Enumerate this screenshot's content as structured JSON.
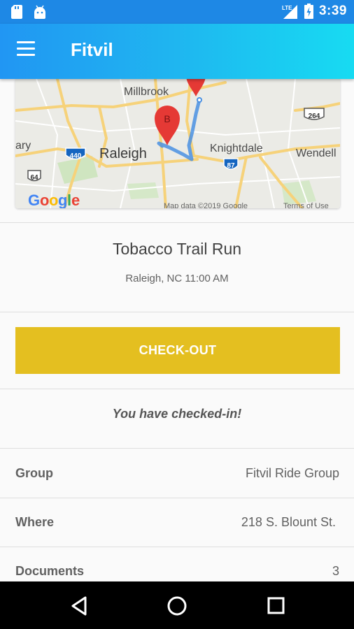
{
  "status_bar": {
    "time": "3:39",
    "network_label": "LTE",
    "icons": [
      "sd-card-icon",
      "android-icon",
      "signal-icon",
      "battery-charging-icon"
    ]
  },
  "app_bar": {
    "title": "Fitvil",
    "menu_icon": "hamburger-menu-icon"
  },
  "map": {
    "labels": {
      "millbrook": "Millbrook",
      "raleigh": "Raleigh",
      "knightdale": "Knightdale",
      "wendell": "Wendell",
      "cary": "ary"
    },
    "shields": {
      "i440": "440",
      "i87": "87",
      "us264": "264",
      "us64": "64"
    },
    "marker_b": "B",
    "attribution": "Map data ©2019 Google",
    "terms": "Terms of Use",
    "logo_text": "Google"
  },
  "event": {
    "title": "Tobacco Trail Run",
    "subtitle": "Raleigh, NC 11:00 AM"
  },
  "checkout": {
    "label": "CHECK-OUT",
    "color": "#e4bf20"
  },
  "status_message": "You have checked-in!",
  "details": [
    {
      "label": "Group",
      "value": "Fitvil Ride Group"
    },
    {
      "label": "Where",
      "value": "218 S. Blount St."
    },
    {
      "label": "Documents",
      "value": "3"
    }
  ],
  "nav_bar": {
    "icons": [
      "back-icon",
      "home-icon",
      "recents-icon"
    ]
  },
  "colors": {
    "app_bar_start": "#2196f3",
    "app_bar_end": "#17dbf2",
    "status_bar": "#1e88e5",
    "route": "#4a90e2",
    "marker": "#e53935"
  }
}
